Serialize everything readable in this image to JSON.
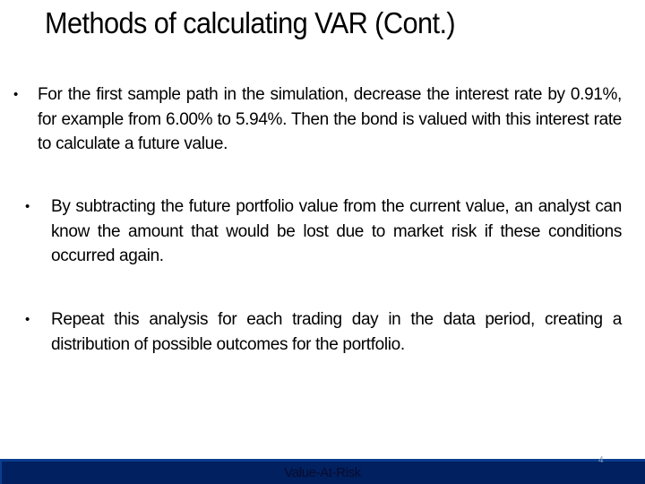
{
  "slide": {
    "title": "Methods of calculating VAR (Cont.)",
    "bullets": [
      {
        "marker": "•",
        "text": "For the first sample path in the simulation, decrease the interest rate by 0.91%, for example from 6.00% to 5.94%.  Then the bond is valued with this interest rate to calculate a future value."
      },
      {
        "marker": "•",
        "text": "By subtracting the future portfolio value from the current value, an analyst can know the amount that would be lost due to market risk if these conditions occurred again."
      },
      {
        "marker": "•",
        "text": "Repeat this analysis for each trading day in the data period, creating a distribution of possible outcomes for the portfolio."
      }
    ]
  },
  "footer": {
    "label": "Value-At-Risk",
    "page_number": "4",
    "colors": {
      "bar_fill": "#00205f",
      "bar_border": "#0a3d8f"
    }
  }
}
